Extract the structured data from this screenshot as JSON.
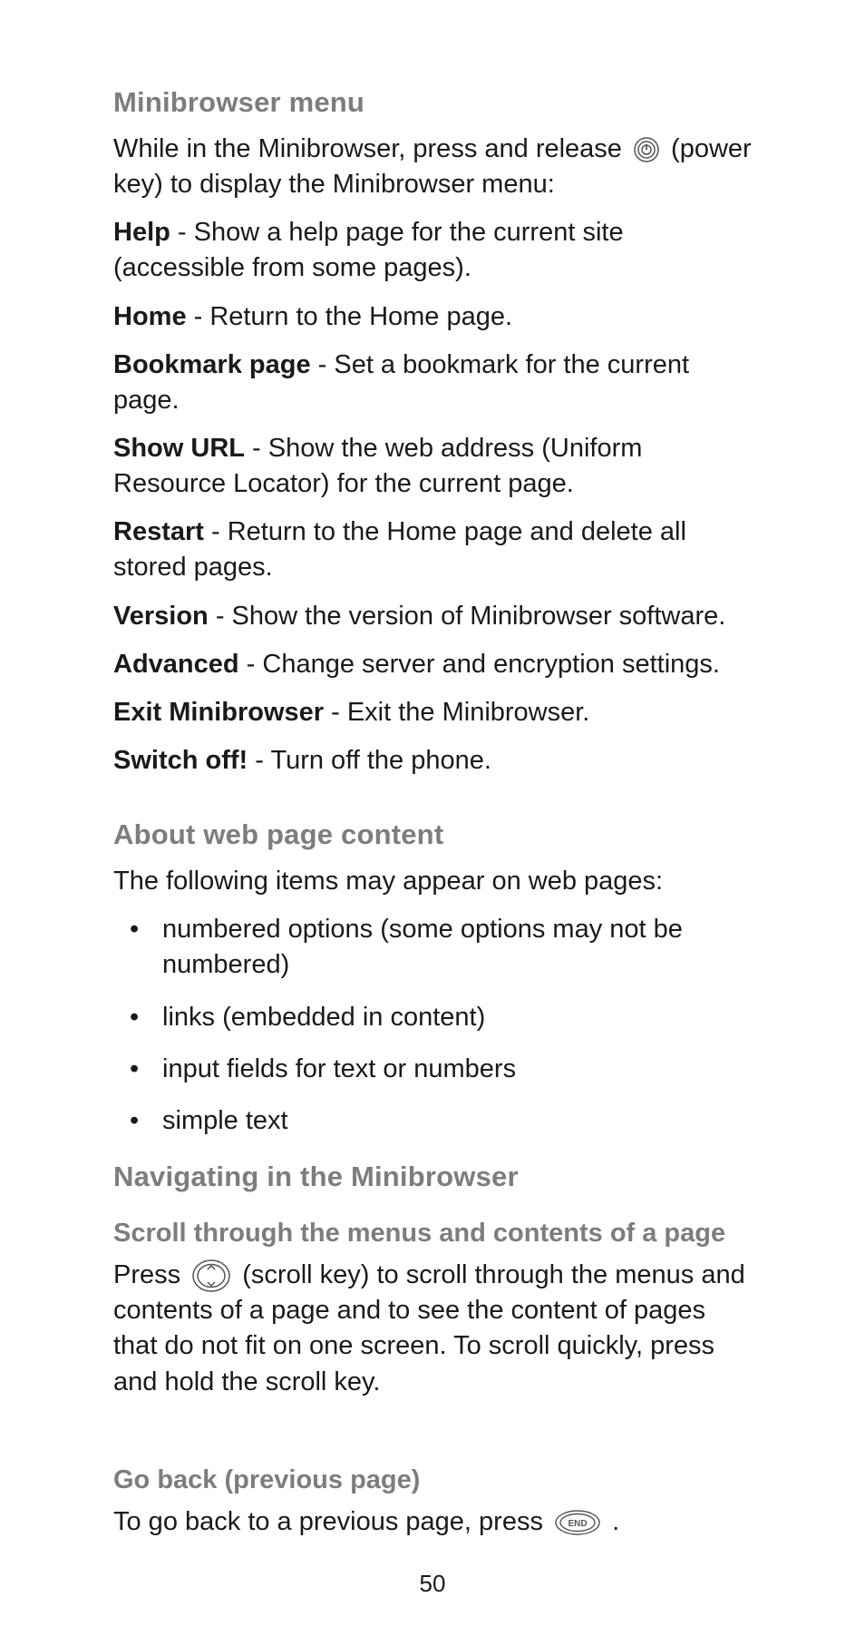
{
  "section1": {
    "heading": "Minibrowser menu",
    "intro_before_icon": "While in the Minibrowser, press and release ",
    "intro_after_icon": " (power key) to display the Minibrowser menu:",
    "items": [
      {
        "label": "Help",
        "desc": " - Show a help page for the current site (accessible from some pages)."
      },
      {
        "label": "Home",
        "desc": " - Return to the Home page."
      },
      {
        "label": "Bookmark page",
        "desc": " - Set a bookmark for the current page."
      },
      {
        "label": "Show URL",
        "desc": " - Show the web address (Uniform Resource Locator) for the current page."
      },
      {
        "label": "Restart",
        "desc": " - Return to the Home page and delete all stored pages."
      },
      {
        "label": "Version",
        "desc": " - Show the version of Minibrowser software."
      },
      {
        "label": "Advanced",
        "desc": " - Change server and encryption settings."
      },
      {
        "label": "Exit Minibrowser",
        "desc": " - Exit the Minibrowser."
      },
      {
        "label": "Switch off!",
        "desc": " - Turn off the phone."
      }
    ]
  },
  "section2": {
    "heading": "About web page content",
    "intro": "The following items may appear on web pages:",
    "bullets": [
      "numbered options (some options may not be numbered)",
      "links (embedded in content)",
      "input fields for text or numbers",
      "simple text"
    ]
  },
  "section3": {
    "heading": "Navigating in the Minibrowser",
    "sub1_heading": "Scroll through the menus and contents of a page",
    "sub1_before_icon": "Press ",
    "sub1_after_icon": " (scroll key) to scroll through the menus and contents of a page and to see the content of pages that do not fit on one screen. To scroll quickly, press and hold the scroll key.",
    "sub2_heading": "Go back (previous page)",
    "sub2_before_icon": "To go back to a previous page, press ",
    "sub2_after_icon": "."
  },
  "page_number": "50"
}
